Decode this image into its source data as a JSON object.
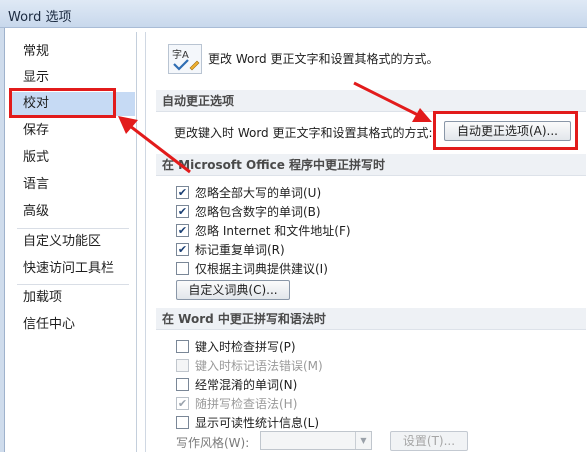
{
  "window": {
    "title": "Word 选项"
  },
  "sidebar": {
    "items": [
      {
        "label": "常规"
      },
      {
        "label": "显示"
      },
      {
        "label": "校对"
      },
      {
        "label": "保存"
      },
      {
        "label": "版式"
      },
      {
        "label": "语言"
      },
      {
        "label": "高级"
      },
      {
        "label": "自定义功能区"
      },
      {
        "label": "快速访问工具栏"
      },
      {
        "label": "加载项"
      },
      {
        "label": "信任中心"
      }
    ],
    "selected": "校对"
  },
  "header": {
    "icon": "abc-check-icon",
    "icon_text": "字A",
    "description": "更改 Word 更正文字和设置其格式的方式。"
  },
  "autocorrect": {
    "section_title": "自动更正选项",
    "row_label": "更改键入时 Word 更正文字和设置其格式的方式:",
    "button_label": "自动更正选项(A)..."
  },
  "office_spelling": {
    "section_title": "在 Microsoft Office 程序中更正拼写时",
    "options": [
      {
        "label": "忽略全部大写的单词(U)",
        "checked": true
      },
      {
        "label": "忽略包含数字的单词(B)",
        "checked": true
      },
      {
        "label": "忽略 Internet 和文件地址(F)",
        "checked": true
      },
      {
        "label": "标记重复单词(R)",
        "checked": true
      },
      {
        "label": "仅根据主词典提供建议(I)",
        "checked": false
      }
    ],
    "dictionary_button": "自定义词典(C)..."
  },
  "word_spelling": {
    "section_title": "在 Word 中更正拼写和语法时",
    "options": [
      {
        "label": "键入时检查拼写(P)",
        "checked": false,
        "disabled": false
      },
      {
        "label": "键入时标记语法错误(M)",
        "checked": false,
        "disabled": true
      },
      {
        "label": "经常混淆的单词(N)",
        "checked": false,
        "disabled": false
      },
      {
        "label": "随拼写检查语法(H)",
        "checked": true,
        "disabled": true
      },
      {
        "label": "显示可读性统计信息(L)",
        "checked": false,
        "disabled": false
      }
    ],
    "style_label": "写作风格(W):",
    "style_value": "",
    "settings_button": "设置(T)..."
  },
  "annotation_color": "#e21b1b"
}
